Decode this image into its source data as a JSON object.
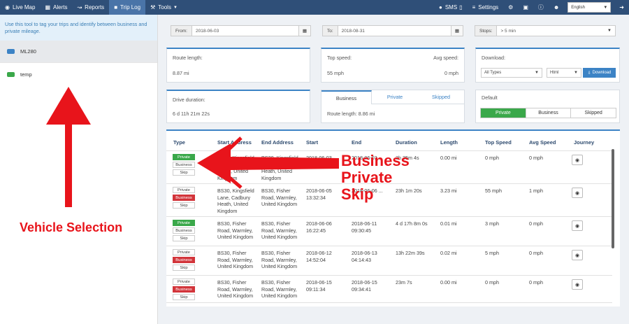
{
  "nav": {
    "left": [
      {
        "label": "Live Map",
        "icon": "map-pin-icon"
      },
      {
        "label": "Alerts",
        "icon": "calendar-icon"
      },
      {
        "label": "Reports",
        "icon": "line-chart-icon"
      },
      {
        "label": "Trip Log",
        "icon": "car-icon",
        "active": true
      },
      {
        "label": "Tools",
        "icon": "wrench-icon",
        "dropdown": true
      }
    ],
    "sms_label": "SMS",
    "settings_label": "Settings",
    "language": "English"
  },
  "sidebar": {
    "hint": "Use this tool to tag your trips and identify between business and private mileage.",
    "vehicles": [
      {
        "name": "ML280",
        "color": "#3c83c5",
        "selected": true
      },
      {
        "name": "temp",
        "color": "#3aa84a",
        "selected": false
      }
    ]
  },
  "annotations": {
    "vehicle_selection": "Vehicle Selection",
    "business": "Business",
    "private": "Private",
    "skip": "Skip"
  },
  "filters": {
    "from_label": "From:",
    "from_value": "2018-06-03",
    "to_label": "To:",
    "to_value": "2018-08-31",
    "stops_label": "Stops:",
    "stops_value": "> 5 min"
  },
  "summary": {
    "route_length_label": "Route length:",
    "route_length_value": "8.87 mi",
    "top_speed_label": "Top speed:",
    "top_speed_value": "55 mph",
    "avg_speed_label": "Avg speed:",
    "avg_speed_value": "0 mph",
    "download_label": "Download:",
    "download_type": "All Types",
    "download_format": "Html",
    "download_button": "Download",
    "drive_duration_label": "Drive duration:",
    "drive_duration_value": "6 d 11h 21m 22s",
    "tabs": [
      "Business",
      "Private",
      "Skipped"
    ],
    "tab_route_length": "Route length: 8.86 mi",
    "default_label": "Default",
    "default_options": [
      "Private",
      "Business",
      "Skipped"
    ]
  },
  "table": {
    "headers": [
      "Type",
      "Start Address",
      "End Address",
      "Start",
      "End",
      "Duration",
      "Length",
      "Top Speed",
      "Avg Speed",
      "Journey"
    ],
    "type_labels": [
      "Private",
      "Business",
      "Skip"
    ],
    "rows": [
      {
        "type": "Private",
        "start_address": "BS30, Kingsfield Lane, Cadbury Heath, United Kingdom",
        "end_address": "BS30, Kingsfield Lane, Cadbury Heath, United Kingdom",
        "start": "2018-06-03 ...",
        "end": "2018-06-03 ...",
        "duration": "3h 35m 4s",
        "length": "0.00 mi",
        "top_speed": "0 mph",
        "avg_speed": "0 mph"
      },
      {
        "type": "Business",
        "start_address": "BS30, Kingsfield Lane, Cadbury Heath, United Kingdom",
        "end_address": "BS30, Fisher Road, Warmley, United Kingdom",
        "start": "2018-06-05 13:32:34",
        "end": "2018-06-06 ...",
        "duration": "23h 1m 20s",
        "length": "3.23 mi",
        "top_speed": "55 mph",
        "avg_speed": "1 mph"
      },
      {
        "type": "Private",
        "start_address": "BS30, Fisher Road, Warmley, United Kingdom",
        "end_address": "BS30, Fisher Road, Warmley, United Kingdom",
        "start": "2018-06-06 16:22:45",
        "end": "2018-06-11 09:30:45",
        "duration": "4 d 17h 8m 0s",
        "length": "0.01 mi",
        "top_speed": "3 mph",
        "avg_speed": "0 mph"
      },
      {
        "type": "Business",
        "start_address": "BS30, Fisher Road, Warmley, United Kingdom",
        "end_address": "BS30, Fisher Road, Warmley, United Kingdom",
        "start": "2018-06-12 14:52:04",
        "end": "2018-06-13 04:14:43",
        "duration": "13h 22m 39s",
        "length": "0.02 mi",
        "top_speed": "5 mph",
        "avg_speed": "0 mph"
      },
      {
        "type": "Business",
        "start_address": "BS30, Fisher Road, Warmley, United Kingdom",
        "end_address": "BS30, Fisher Road, Warmley, United Kingdom",
        "start": "2018-06-15 09:11:34",
        "end": "2018-06-15 09:34:41",
        "duration": "23m 7s",
        "length": "0.00 mi",
        "top_speed": "0 mph",
        "avg_speed": "0 mph"
      }
    ]
  }
}
